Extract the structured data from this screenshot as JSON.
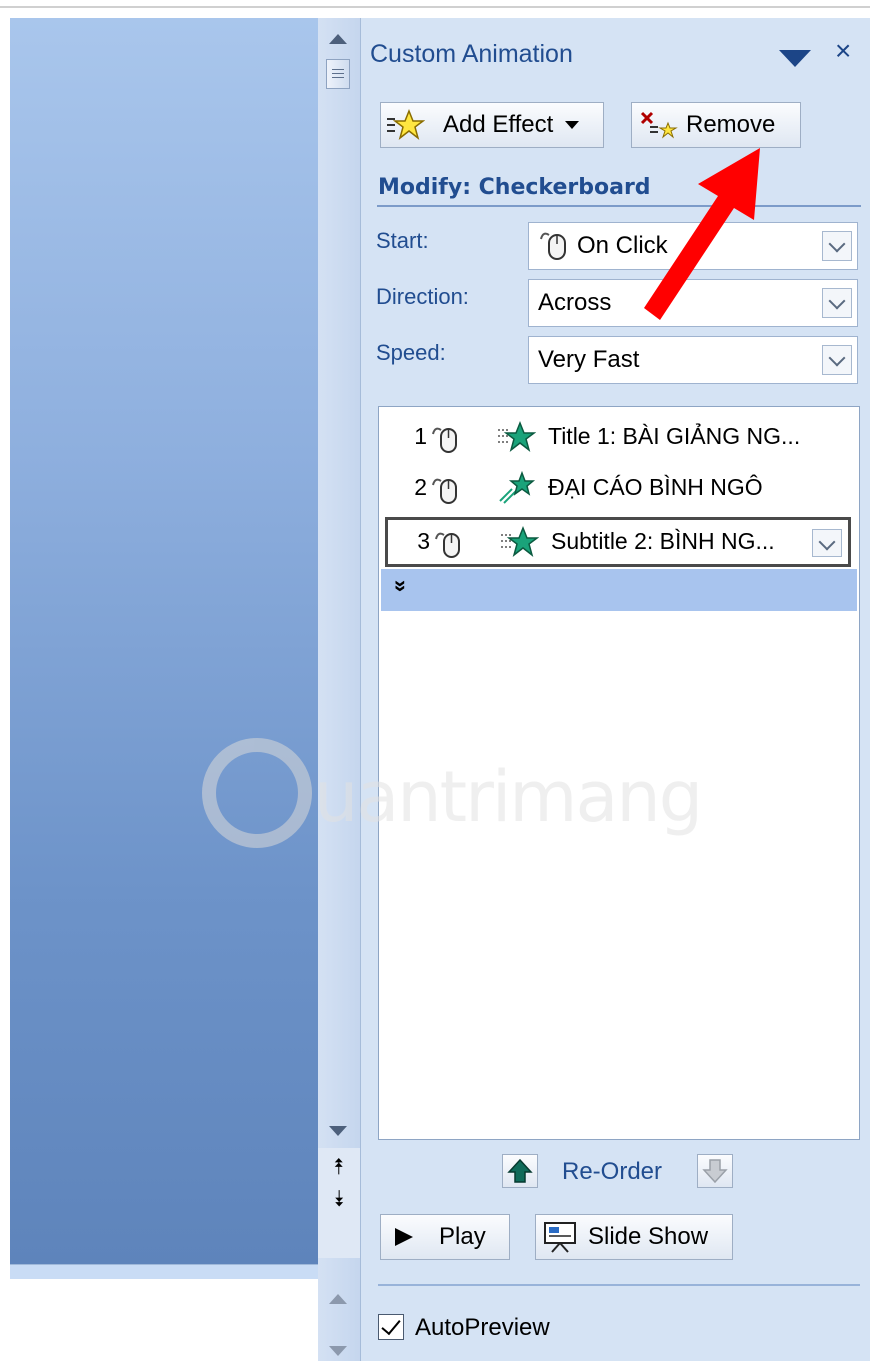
{
  "pane": {
    "title": "Custom Animation",
    "menu_icon": "triangle-down-icon",
    "close_label": "×"
  },
  "toolbar": {
    "add_effect_label": "Add Effect",
    "remove_label": "Remove"
  },
  "modify": {
    "title": "Modify: Checkerboard",
    "start_label": "Start:",
    "start_value": "On Click",
    "direction_label": "Direction:",
    "direction_value": "Across",
    "speed_label": "Speed:",
    "speed_value": "Very Fast"
  },
  "animation_list": {
    "items": [
      {
        "num": "1",
        "text": "Title 1: BÀI GIẢNG NG..."
      },
      {
        "num": "2",
        "text": "ĐẠI CÁO BÌNH NGÔ"
      },
      {
        "num": "3",
        "text": "Subtitle 2: BÌNH NG..."
      }
    ],
    "selected_index": 3,
    "expand_glyph": "»"
  },
  "reorder": {
    "label": "Re-Order"
  },
  "playback": {
    "play_label": "Play",
    "slideshow_label": "Slide Show"
  },
  "autopreview": {
    "label": "AutoPreview",
    "checked": true
  },
  "watermark": {
    "text": "uantrimang"
  },
  "colors": {
    "accent_text": "#214d90",
    "pane_bg": "#d5e3f4",
    "selection_row": "#a8c4ee",
    "annotation_arrow": "#ff0000"
  }
}
